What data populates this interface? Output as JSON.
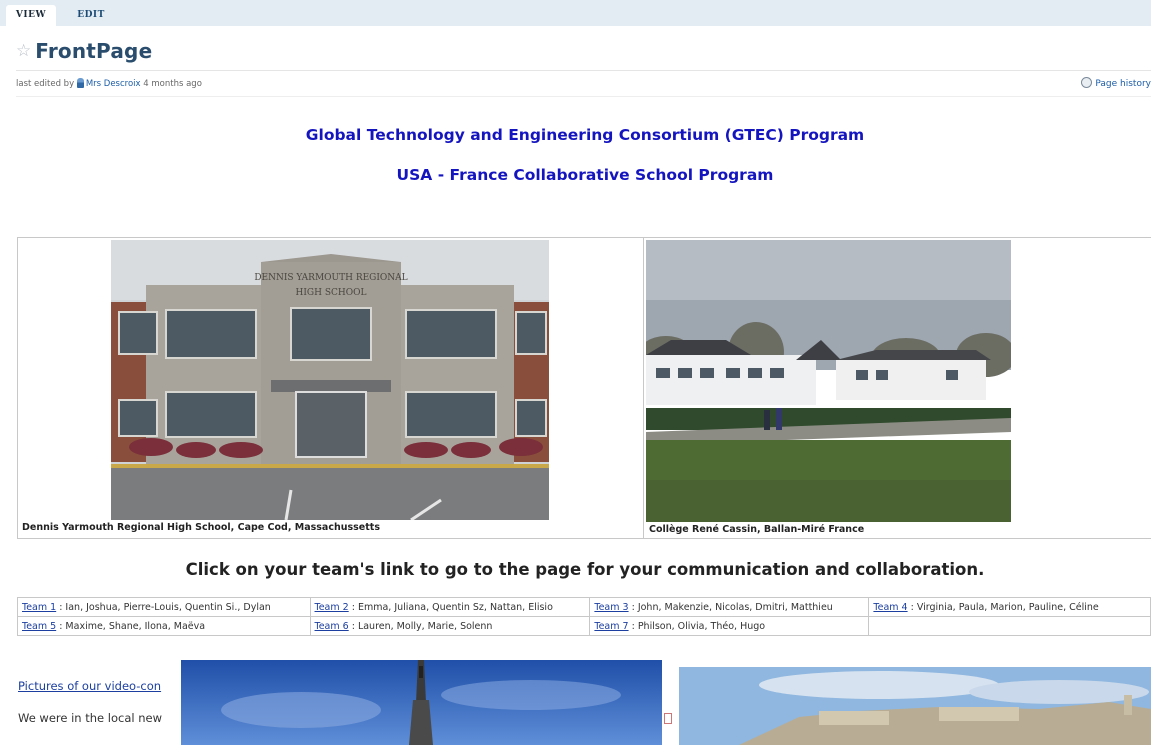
{
  "tabs": {
    "view": "VIEW",
    "edit": "EDIT"
  },
  "page": {
    "title": "FrontPage",
    "star_icon": "star-icon"
  },
  "meta": {
    "prefix": "last edited by",
    "user": "Mrs Descroix",
    "time": "4 months ago",
    "history": "Page history"
  },
  "headings": {
    "line1": "Global Technology and Engineering Consortium (GTEC) Program",
    "line2": "USA - France Collaborative School Program",
    "color": "#1515c0"
  },
  "photos": {
    "left_caption": "Dennis Yarmouth Regional High School, Cape Cod, Massachussetts",
    "right_caption": "Collège René Cassin, Ballan-Miré France",
    "sign_line1": "DENNIS YARMOUTH REGIONAL",
    "sign_line2": "HIGH SCHOOL"
  },
  "click_text": "Click on your team's link to go to the page for your communication and collaboration.",
  "teams": [
    {
      "link": "Team 1",
      "members": " :  Ian, Joshua, Pierre-Louis, Quentin Si., Dylan"
    },
    {
      "link": "Team 2",
      "members": " :  Emma, Juliana, Quentin Sz, Nattan, Elisio"
    },
    {
      "link": "Team 3",
      "members": " : John, Makenzie, Nicolas, Dmitri, Matthieu"
    },
    {
      "link": "Team 4",
      "members": " : Virginia, Paula, Marion, Pauline, Céline"
    },
    {
      "link": "Team 5",
      "members": " : Maxime, Shane, Ilona, Maëva"
    },
    {
      "link": "Team 6",
      "members": " : Lauren, Molly, Marie, Solenn"
    },
    {
      "link": "Team 7",
      "members": " : Philson, Olivia, Théo, Hugo"
    }
  ],
  "bottom": {
    "video_link": "Pictures of our video-con",
    "news_text": "We were in the local new"
  }
}
